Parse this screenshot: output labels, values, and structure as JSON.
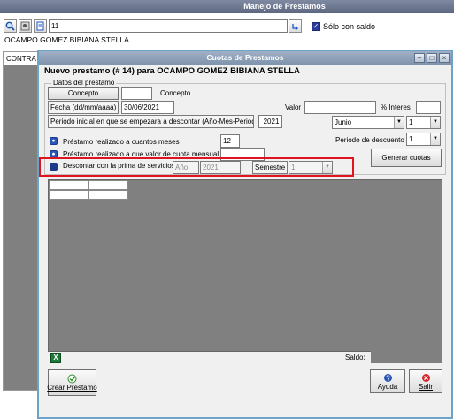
{
  "back_window": {
    "title": "Manejo de Prestamos",
    "search_value": "11",
    "solo_saldo_label": "Sólo con saldo",
    "client_name": "OCAMPO GOMEZ BIBIANA STELLA",
    "contract_label": "CONTRA"
  },
  "dialog": {
    "title": "Cuotas de Prestamos",
    "heading": "Nuevo prestamo (# 14) para OCAMPO GOMEZ BIBIANA STELLA",
    "group_label": "Datos del prestamo",
    "concepto_button": "Concepto",
    "concepto_code": "",
    "concepto_label": "Concepto",
    "fecha_label": "Fecha (dd/mm/aaaa)",
    "fecha_value": "30/06/2021",
    "valor_label": "Valor",
    "valor_value": "",
    "interes_label": "% Interes",
    "interes_value": "",
    "periodo_label": "Periodo inicial en que se empezara a descontar  (Año-Mes-Periodo)",
    "periodo_year": "2021",
    "periodo_month": "Junio",
    "periodo_num": "1",
    "periodo_descuento_label": "Periodo de descuento",
    "periodo_descuento_value": "1",
    "radio_meses_label": "Préstamo realizado a cuantos meses",
    "radio_meses_value": "12",
    "radio_cuota_label": "Préstamo realizado a que valor de cuota mensual",
    "radio_cuota_value": "",
    "radio_prima_label": "Descontar con la prima de servicios",
    "anio_label": "Año",
    "anio_value": "2021",
    "semestre_label": "Semestre",
    "semestre_value": "1",
    "generar_button": "Generar cuotas",
    "saldo_label": "Saldo:",
    "crear_button": "Crear Préstamo",
    "ayuda_button": "Ayuda",
    "salir_button": "Salir"
  },
  "colors": {
    "highlight_box": "#e0141e",
    "grid_bg": "#808080",
    "excel_green": "#1d7a3a"
  }
}
